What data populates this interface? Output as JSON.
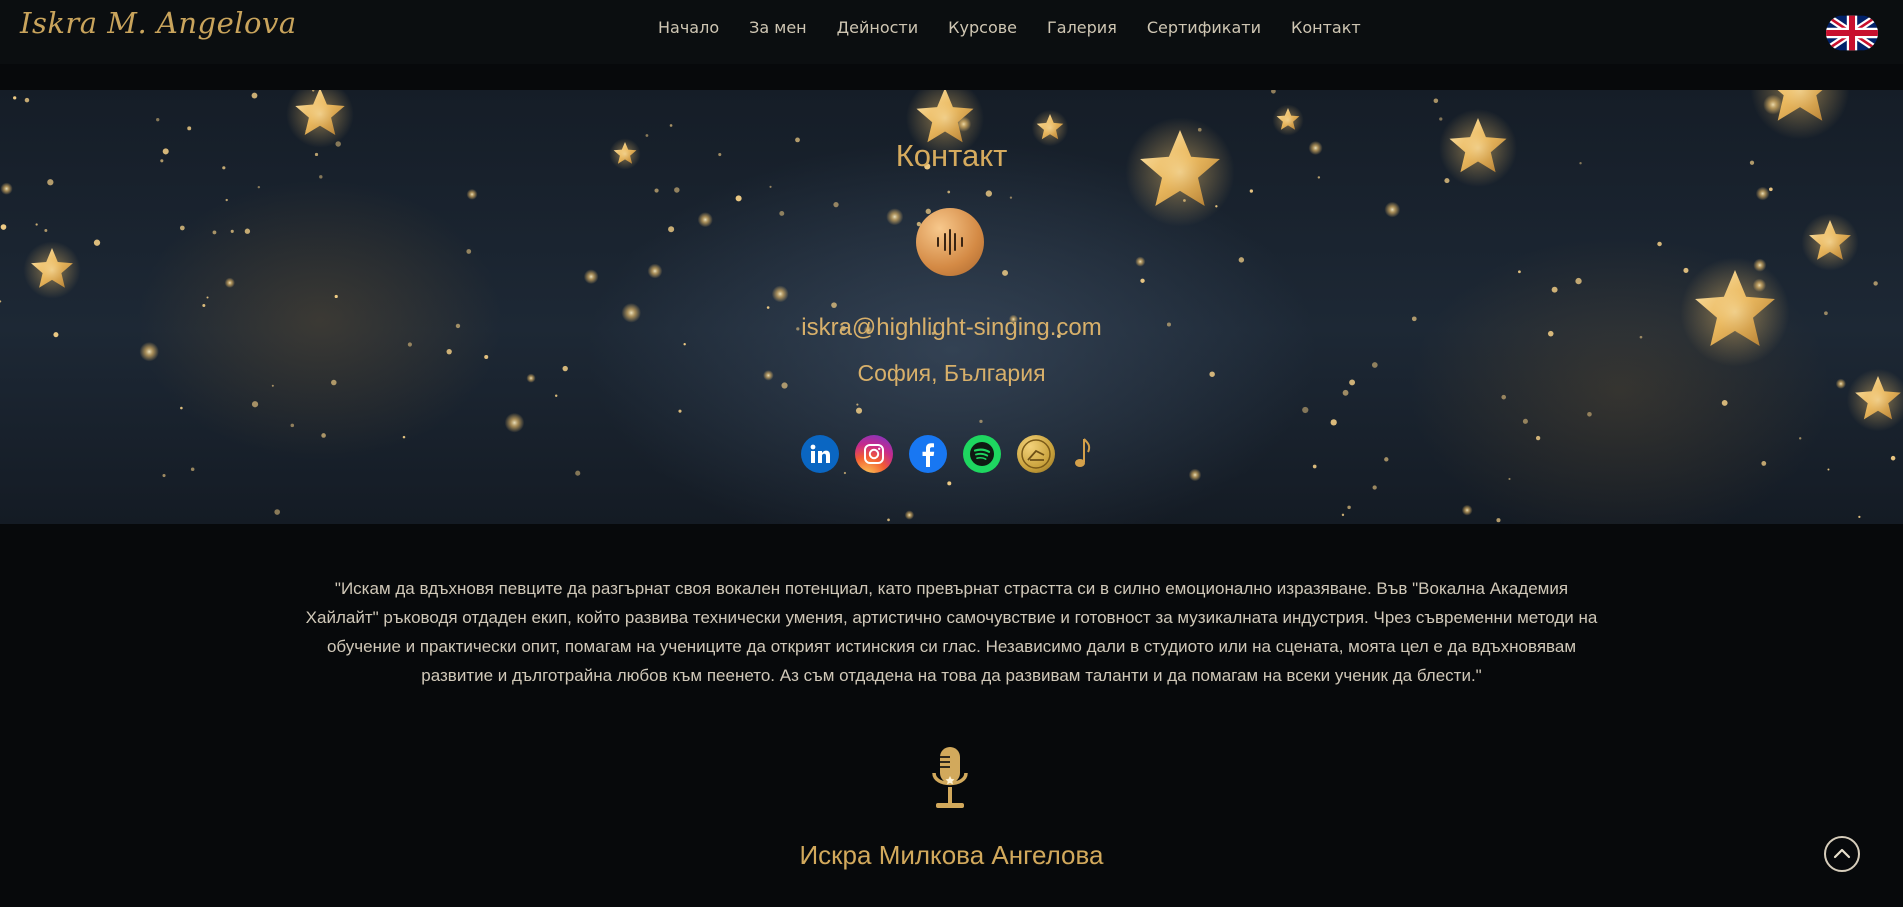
{
  "header": {
    "logo": "Iskra M. Angelova",
    "nav": [
      "Начало",
      "За мен",
      "Дейности",
      "Курсове",
      "Галерия",
      "Сертификати",
      "Контакт"
    ],
    "language_icon": "uk-flag-icon"
  },
  "hero": {
    "title": "Контакт",
    "badge_icon": "sound-wave-icon",
    "email": "iskra@highlight-singing.com",
    "city": "София, България",
    "socials": [
      {
        "icon": "linkedin-icon",
        "color": "#0a66c2"
      },
      {
        "icon": "instagram-icon",
        "color": "#e1306c"
      },
      {
        "icon": "facebook-icon",
        "color": "#1877f2"
      },
      {
        "icon": "spotify-icon",
        "color": "#1ed760"
      },
      {
        "icon": "coin-icon",
        "color": "#c9a23c"
      },
      {
        "icon": "music-note-icon",
        "color": "#d4a04a"
      }
    ]
  },
  "quote": "\"Искам да вдъхновя певците да разгърнат своя вокален потенциал, като превърнат страстта си в силно емоционално изразяване. Във \"Вокална Академия Хайлайт\" ръководя отдаден екип, който развива технически умения, артистично самочувствие и готовност за музикалната индустрия. Чрез съвременни методи на обучение и практически опит, помагам на учениците да открият истинския си глас. Независимо дали в студиото или на сцената, моята цел е да вдъхновявам развитие и дълготрайна любов към пеенето. Аз съм отдадена на това да развивам таланти и да помагам на всеки ученик да блести.\"",
  "signature": "Искра Милкова Ангелова",
  "accent_color": "#d2a95c"
}
